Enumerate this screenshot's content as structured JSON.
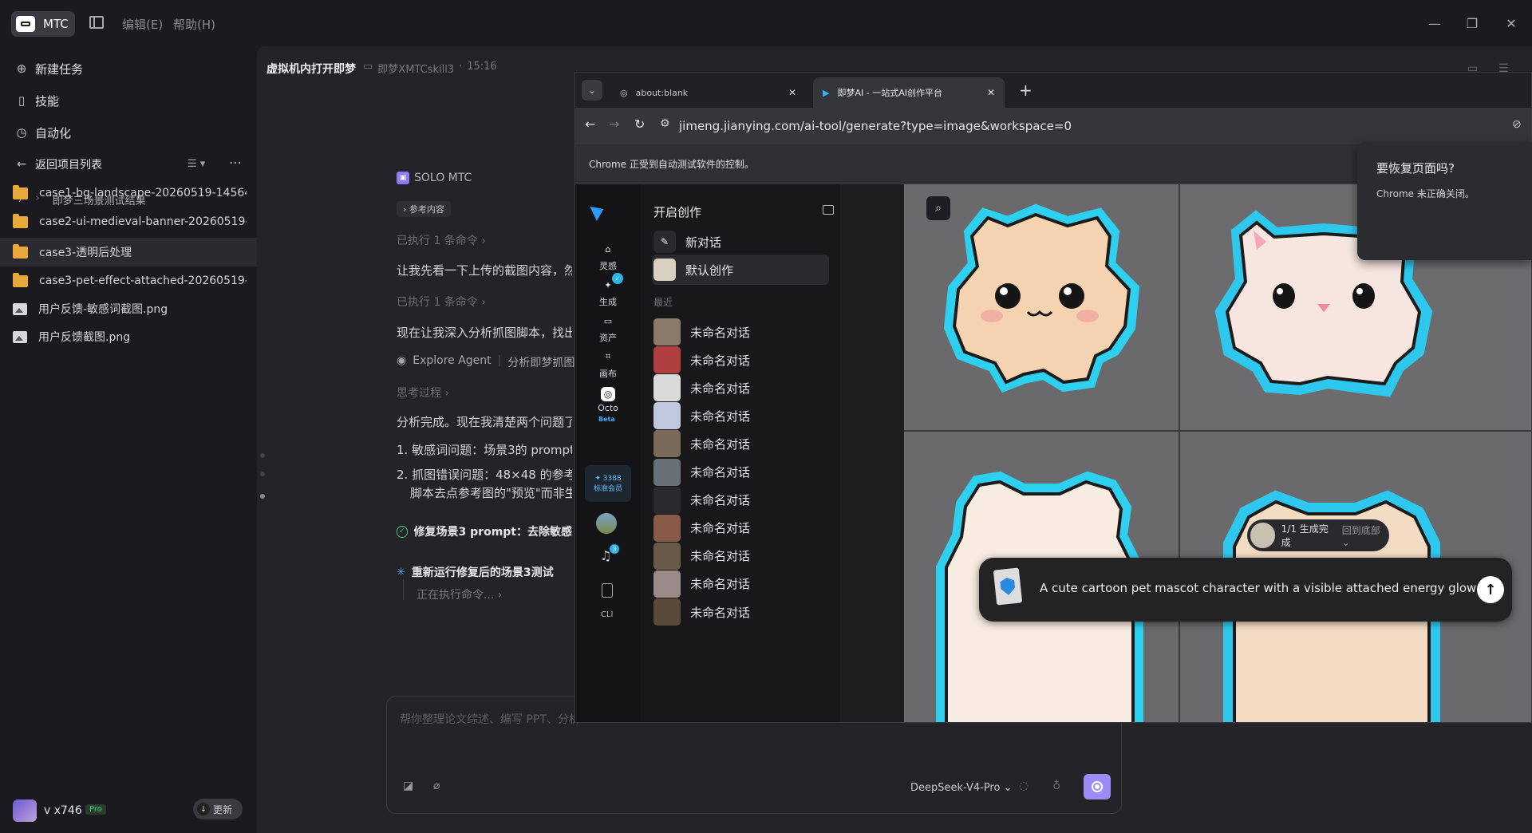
{
  "app": {
    "name": "MTC",
    "menu_edit": "编辑(E)",
    "menu_help": "帮助(H)"
  },
  "sidebar": {
    "new_task": "新建任务",
    "skills": "技能",
    "automation": "自动化",
    "back": "返回项目列表",
    "breadcrumb_sep": "/",
    "breadcrumb": "即梦三场景测试结果",
    "files": [
      {
        "name": "case1-bg-landscape-20260519-145642",
        "type": "folder"
      },
      {
        "name": "case2-ui-medieval-banner-20260519-15...",
        "type": "folder"
      },
      {
        "name": "case3-透明后处理",
        "type": "folder"
      },
      {
        "name": "case3-pet-effect-attached-20260519-15...",
        "type": "folder"
      },
      {
        "name": "用户反馈-敏感词截图.png",
        "type": "image"
      },
      {
        "name": "用户反馈截图.png",
        "type": "image"
      }
    ],
    "user": {
      "name": "v x746",
      "badge": "Pro",
      "update": "更新"
    }
  },
  "task": {
    "title": "虚拟机内打开即梦",
    "folder": "即梦XMTCskill3",
    "time": "15:16"
  },
  "chat": {
    "agent": "SOLO MTC",
    "ref": "参考内容",
    "exec1": "已执行 1 条命令",
    "msg1": "让我先看一下上传的截图内容，然",
    "exec2": "已执行 1 条命令",
    "msg2": "现在让我深入分析抓图脚本，找出",
    "explore_agent": "Explore Agent",
    "explore_desc": "分析即梦抓图",
    "think": "思考过程",
    "msg3": "分析完成。现在我清楚两个问题了",
    "item1": "1. 敏感词问题：场景3的 prompt 中",
    "item2": "2. 抓图错误问题：48×48 的参考图",
    "item2b": "脚本去点参考图的\"预览\"而非生",
    "step1": "修复场景3 prompt：去除敏感",
    "step2": "重新运行修复后的场景3测试",
    "running": "正在执行命令..."
  },
  "input": {
    "placeholder": "帮你整理论文综述、编写 PPT、分析",
    "model": "DeepSeek-V4-Pro"
  },
  "browser": {
    "tab1": "about:blank",
    "tab2": "即梦AI - 一站式AI创作平台",
    "url": "jimeng.jianying.com/ai-tool/generate?type=image&workspace=0",
    "infobar": "Chrome 正受到自动测试软件的控制。",
    "restore_title": "要恢复页面吗?",
    "restore_desc": "Chrome 未正确关闭。"
  },
  "jimeng": {
    "rail": {
      "inspire": "灵感",
      "generate": "生成",
      "assets": "资产",
      "canvas": "画布",
      "octo": "Octo",
      "beta": "Beta",
      "points": "3388",
      "member": "标准会员",
      "notif": "3",
      "cli": "CLI"
    },
    "panel_title": "开启创作",
    "new_chat": "新对话",
    "default": "默认创作",
    "recent": "最近",
    "history": [
      "未命名对话",
      "未命名对话",
      "未命名对话",
      "未命名对话",
      "未命名对话",
      "未命名对话",
      "未命名对话",
      "未命名对话",
      "未命名对话",
      "未命名对话",
      "未命名对话"
    ],
    "status": "1/1 生成完成",
    "back_bottom": "回到底部",
    "prompt": "A cute cartoon pet mascot character with a visible attached energy glow"
  },
  "colors": {
    "accent": "#8b7cf6",
    "folder": "#e8a93a",
    "cyan": "#2fc8e8"
  }
}
